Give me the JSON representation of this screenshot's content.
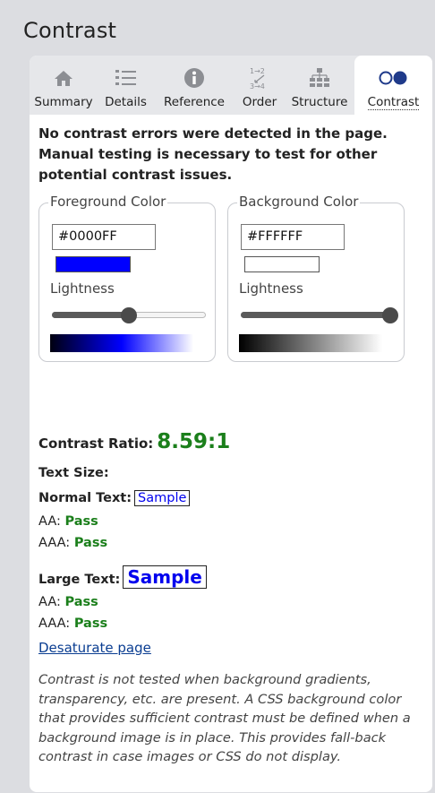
{
  "panel": {
    "title": "Contrast"
  },
  "tabs": [
    {
      "label": "Summary",
      "icon": "home-icon"
    },
    {
      "label": "Details",
      "icon": "list-icon"
    },
    {
      "label": "Reference",
      "icon": "info-icon"
    },
    {
      "label": "Order",
      "icon": "order-icon"
    },
    {
      "label": "Structure",
      "icon": "structure-icon"
    },
    {
      "label": "Contrast",
      "icon": "contrast-icon",
      "active": true
    }
  ],
  "notice": "No contrast errors were detected in the page. Manual testing is necessary to test for other potential contrast issues.",
  "foreground": {
    "legend": "Foreground Color",
    "hex": "#0000FF",
    "swatch_color": "#0000ff",
    "lightness_label": "Lightness",
    "lightness_value": 0.5
  },
  "background": {
    "legend": "Background Color",
    "hex": "#FFFFFF",
    "swatch_color": "#ffffff",
    "lightness_label": "Lightness",
    "lightness_value": 1.0
  },
  "ratio": {
    "label": "Contrast Ratio:",
    "value": "8.59:1"
  },
  "text_size_label": "Text Size:",
  "normal": {
    "label": "Normal Text:",
    "sample": "Sample",
    "aa_label": "AA:",
    "aa": "Pass",
    "aaa_label": "AAA:",
    "aaa": "Pass"
  },
  "large": {
    "label": "Large Text:",
    "sample": "Sample",
    "aa_label": "AA:",
    "aa": "Pass",
    "aaa_label": "AAA:",
    "aaa": "Pass"
  },
  "desaturate_link": "Desaturate page",
  "note": "Contrast is not tested when background gradients, transparency, etc. are present. A CSS background color that provides sufficient contrast must be defined when a background image is in place. This provides fall-back contrast in case images or CSS do not display.",
  "colors": {
    "pass": "#1b7f1b",
    "sample": "#0000ee",
    "link": "#0a3d91"
  }
}
